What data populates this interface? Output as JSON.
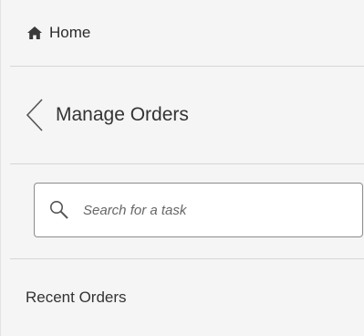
{
  "nav": {
    "home_label": "Home",
    "home_icon": "home-icon",
    "back_label": "Manage Orders",
    "back_icon": "chevron-left-icon"
  },
  "search": {
    "placeholder": "Search for a task",
    "value": "",
    "icon": "search-icon"
  },
  "sections": {
    "recent_orders_label": "Recent Orders"
  },
  "colors": {
    "background": "#f5f5f5",
    "divider": "#d6d6d6",
    "input_border": "#8c8c8c",
    "icon": "#3a3a3a"
  }
}
